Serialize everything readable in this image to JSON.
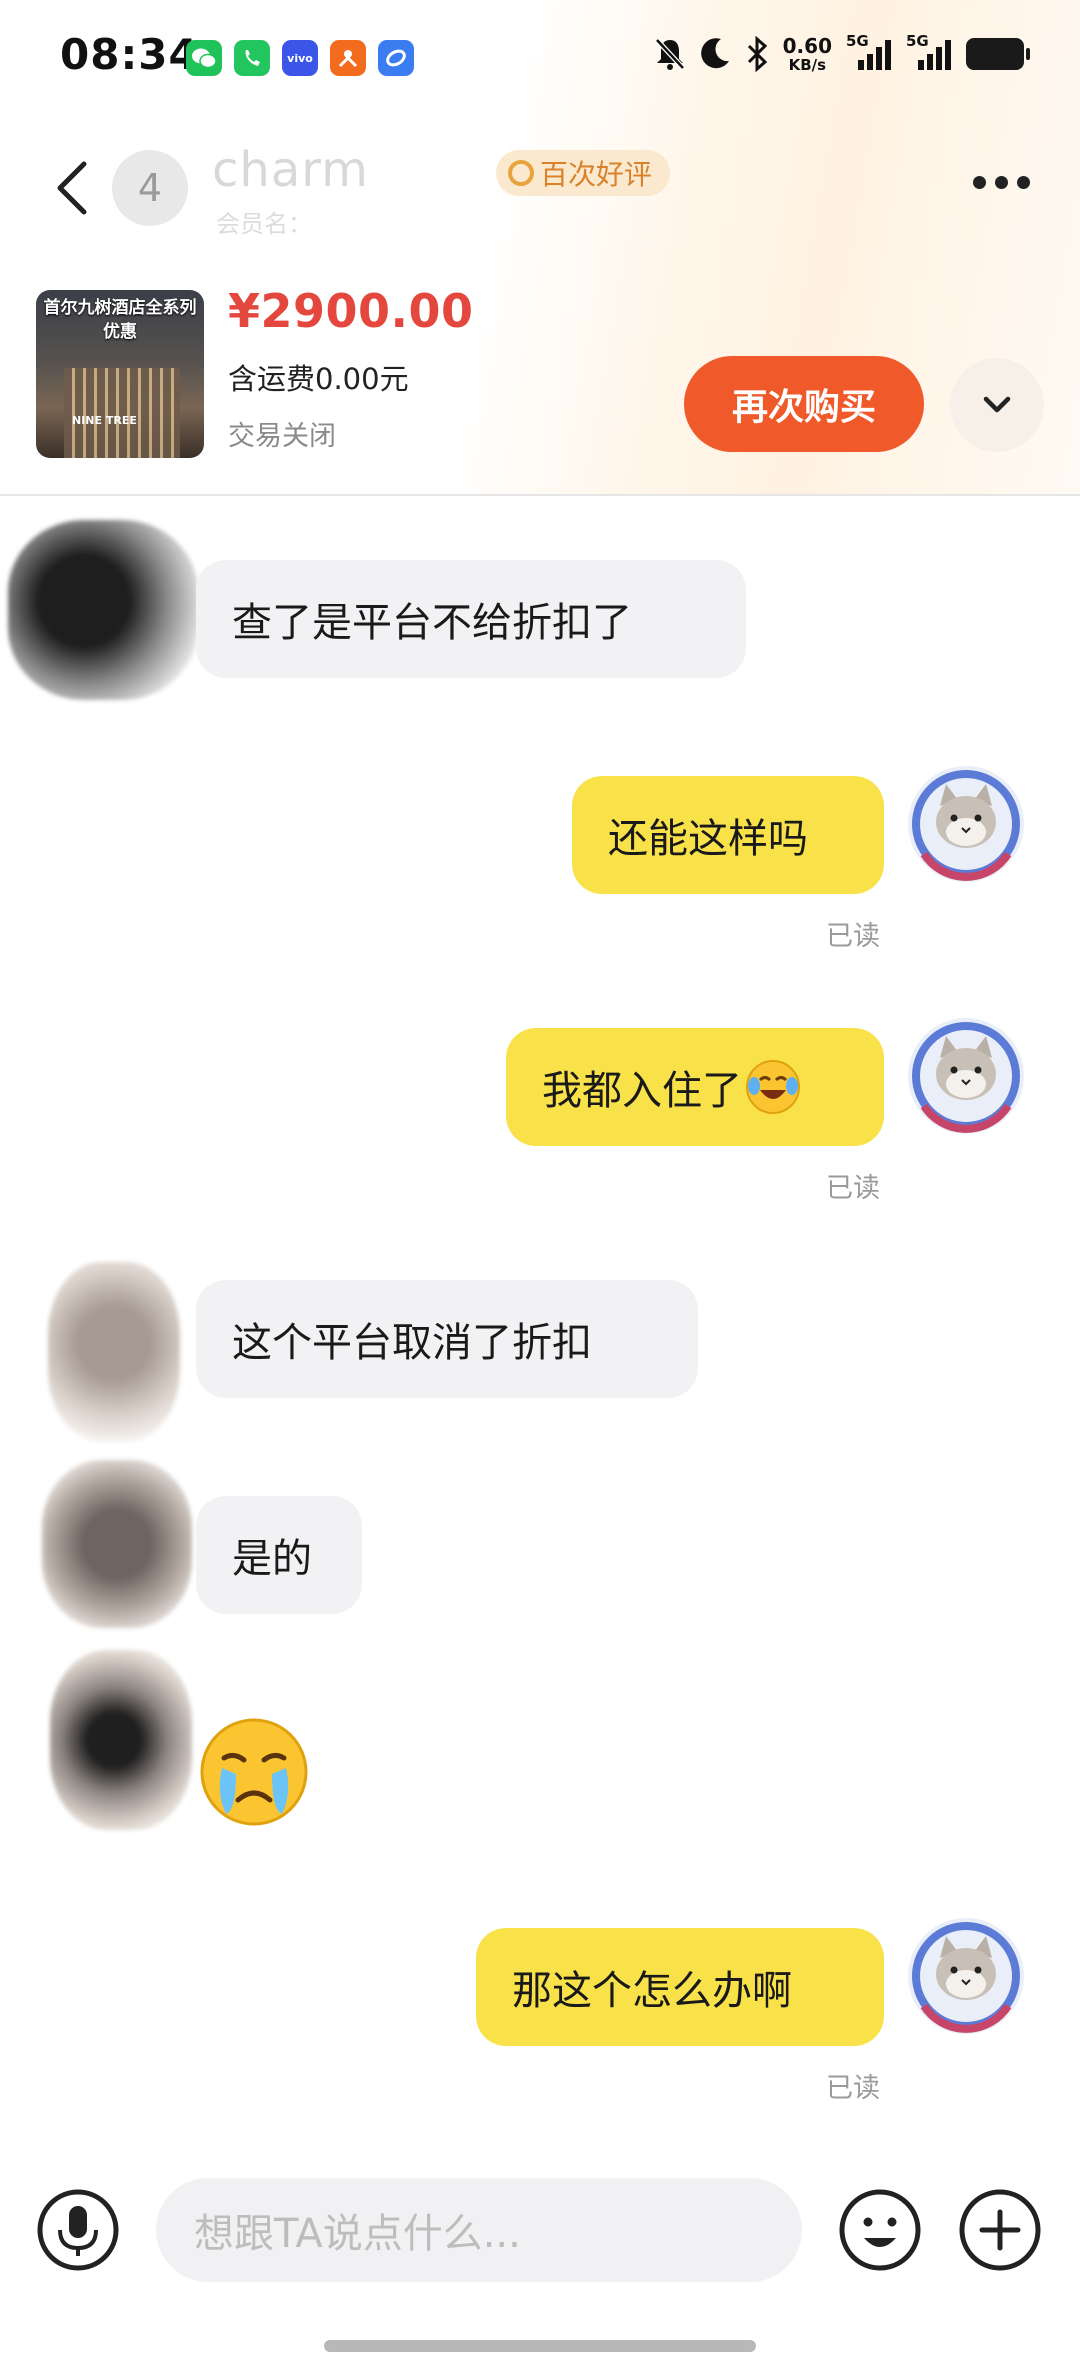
{
  "status_bar": {
    "time": "08:34",
    "network_speed_value": "0.60",
    "network_speed_unit": "KB/s",
    "sim1_label": "5G",
    "sim2_label": "5G",
    "notification_icons": [
      "wechat-icon",
      "phone-app-icon",
      "vivo-icon",
      "orange-app-icon",
      "blue-app-icon"
    ]
  },
  "header": {
    "unread_count": "4",
    "shop_name": "charm",
    "shop_subtitle": "会员名：",
    "badge_label": "百次好评"
  },
  "product": {
    "thumb_title": "首尔九树酒店全系列优惠",
    "thumb_sign": "NINE TREE",
    "price": "¥2900.00",
    "shipping": "含运费0.00元",
    "status": "交易关闭",
    "rebuy_label": "再次购买"
  },
  "messages": [
    {
      "side": "in",
      "text": "查了是平台不给折扣了"
    },
    {
      "side": "out",
      "text": "还能这样吗",
      "read": "已读"
    },
    {
      "side": "out",
      "text": "我都入住了",
      "read": "已读"
    },
    {
      "side": "in",
      "text": "这个平台取消了折扣"
    },
    {
      "side": "in",
      "text": "是的"
    },
    {
      "side": "in",
      "text": ""
    },
    {
      "side": "out",
      "text": "那这个怎么办啊",
      "read": "已读"
    }
  ],
  "input": {
    "placeholder": "想跟TA说点什么..."
  },
  "colors": {
    "price": "#e4473e",
    "rebuy_button": "#f05a2a",
    "outgoing_bubble": "#f9e249",
    "incoming_bubble": "#f2f2f4",
    "badge_text": "#d9822b"
  }
}
